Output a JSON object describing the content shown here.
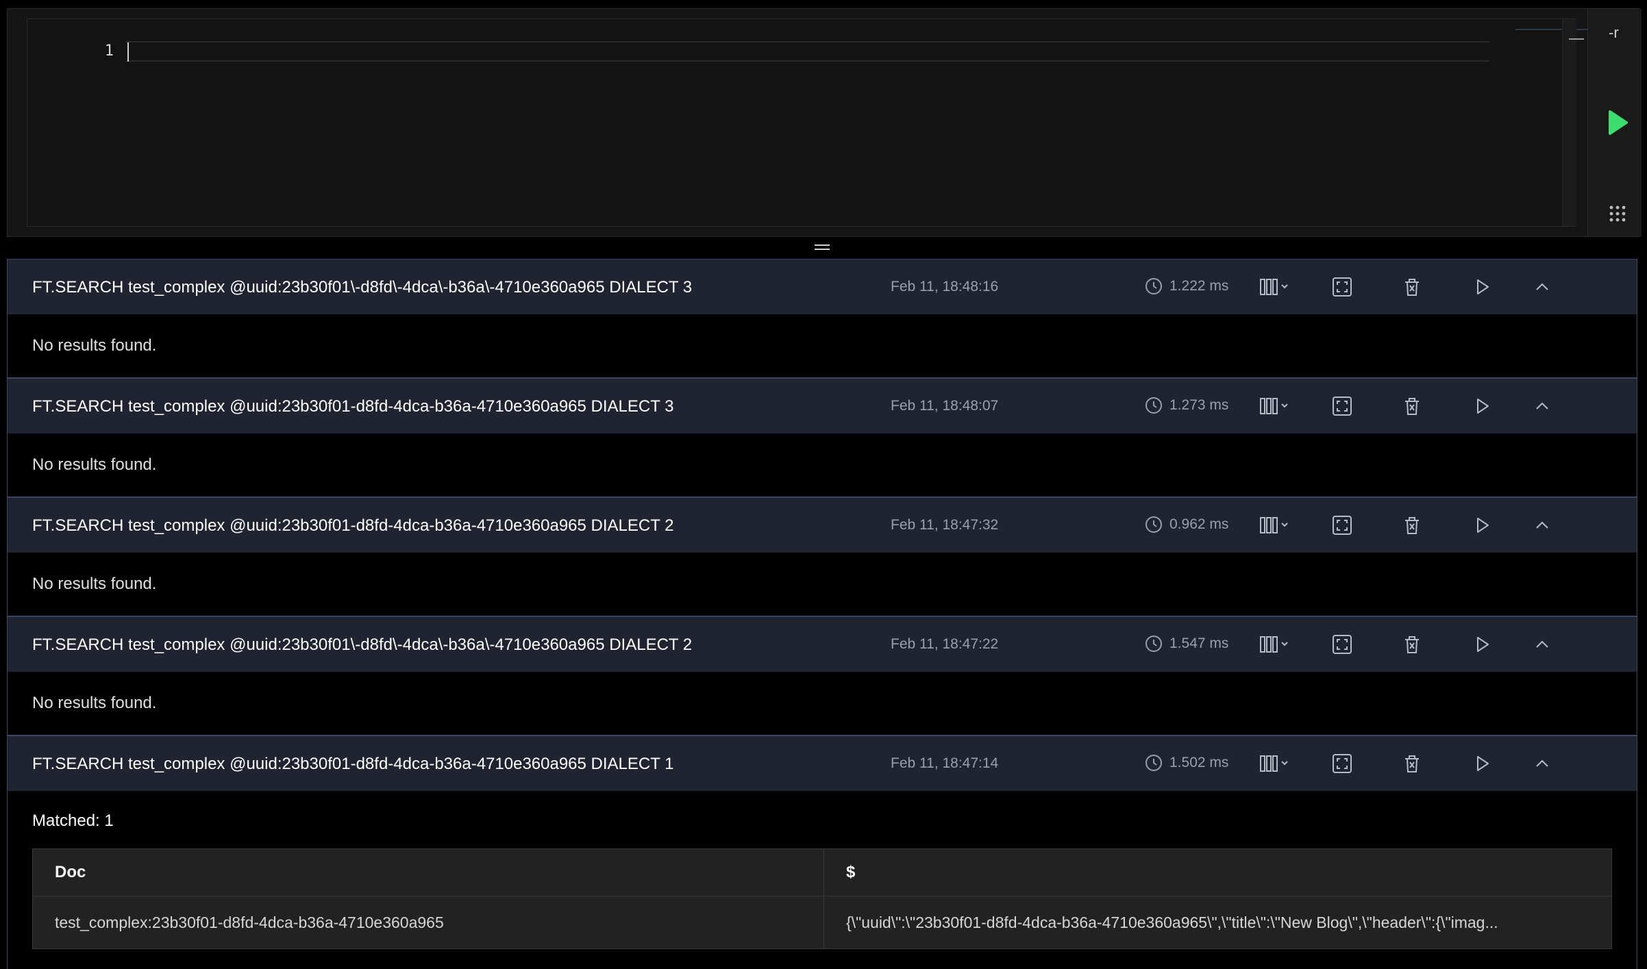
{
  "editor": {
    "line_number": "1",
    "raw_flag": "-r"
  },
  "results": [
    {
      "command": "FT.SEARCH test_complex @uuid:23b30f01\\-d8fd\\-4dca\\-b36a\\-4710e360a965 DIALECT 3",
      "timestamp": "Feb 11, 18:48:16",
      "exec_time": "1.222 ms",
      "body": "No results found."
    },
    {
      "command": "FT.SEARCH test_complex @uuid:23b30f01-d8fd-4dca-b36a-4710e360a965 DIALECT 3",
      "timestamp": "Feb 11, 18:48:07",
      "exec_time": "1.273 ms",
      "body": "No results found."
    },
    {
      "command": "FT.SEARCH test_complex @uuid:23b30f01-d8fd-4dca-b36a-4710e360a965 DIALECT 2",
      "timestamp": "Feb 11, 18:47:32",
      "exec_time": "0.962 ms",
      "body": "No results found."
    },
    {
      "command": "FT.SEARCH test_complex @uuid:23b30f01\\-d8fd\\-4dca\\-b36a\\-4710e360a965 DIALECT 2",
      "timestamp": "Feb 11, 18:47:22",
      "exec_time": "1.547 ms",
      "body": "No results found."
    },
    {
      "command": "FT.SEARCH test_complex @uuid:23b30f01-d8fd-4dca-b36a-4710e360a965 DIALECT 1",
      "timestamp": "Feb 11, 18:47:14",
      "exec_time": "1.502 ms",
      "matched": "Matched: 1",
      "table": {
        "headers": [
          "Doc",
          "$"
        ],
        "rows": [
          [
            "test_complex:23b30f01-d8fd-4dca-b36a-4710e360a965",
            "{\\\"uuid\\\":\\\"23b30f01-d8fd-4dca-b36a-4710e360a965\\\",\\\"title\\\":\\\"New Blog\\\",\\\"header\\\":{\\\"imag..."
          ]
        ]
      }
    }
  ],
  "colors": {
    "run_green": "#3ddc6e",
    "header_bg": "#202431",
    "border_accent": "#3b4566"
  },
  "icons": {
    "run": "play-triangle-icon",
    "clock": "clock-icon",
    "view": "column-view-icon",
    "fullscreen": "fullscreen-icon",
    "delete": "trash-icon",
    "rerun": "play-outline-icon",
    "collapse": "chevron-up-icon"
  }
}
